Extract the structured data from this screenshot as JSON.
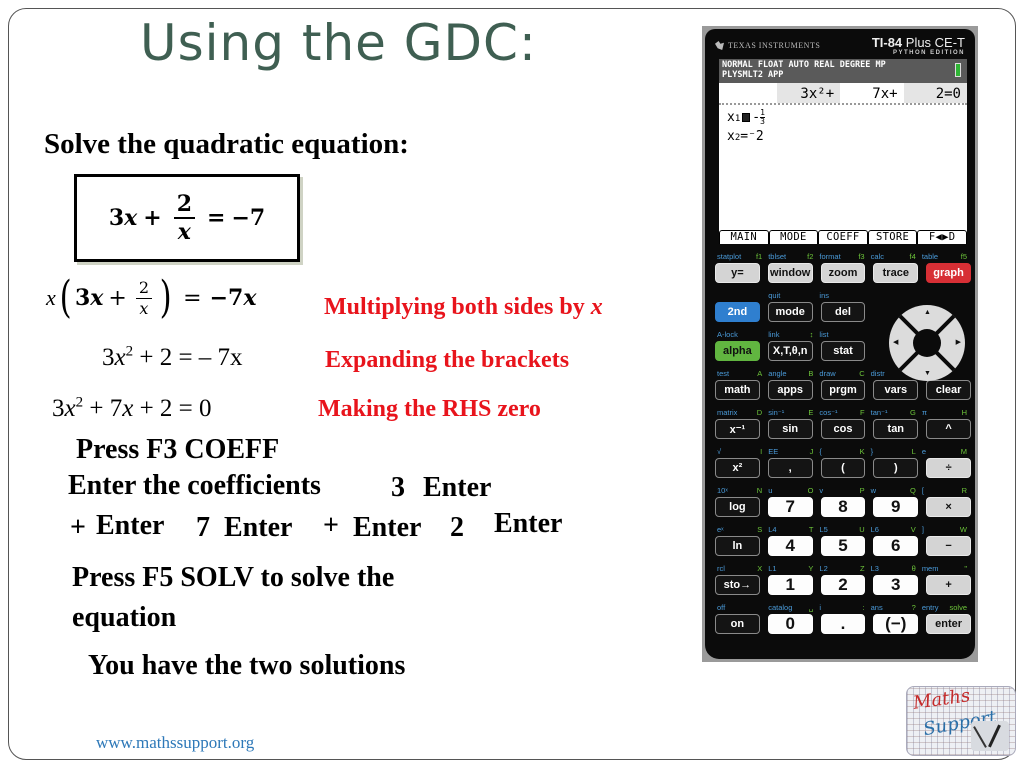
{
  "slide": {
    "title": "Using the GDC:",
    "subtitle": "Solve the quadratic equation:",
    "boxed_equation": {
      "lhs_term": "3",
      "lhs_var": "x",
      "plus": "+",
      "frac_num": "2",
      "frac_den": "x",
      "equals": "=",
      "rhs": "−7"
    },
    "step1": {
      "equation": {
        "lead": "x",
        "term": "3",
        "var": "x",
        "plus": "+",
        "frac_num": "2",
        "frac_den": "x",
        "equals": "=",
        "rhs": "−7",
        "rhs_var": "x"
      },
      "annotation_text": "Multiplying both sides by ",
      "annotation_var": "x"
    },
    "step2": {
      "equation_a": "3",
      "equation_var": "x",
      "equation_exp": "2",
      "equation_b": " + 2 = – 7x",
      "annotation": "Expanding the brackets"
    },
    "step3": {
      "equation_a": "3",
      "equation_var": "x",
      "equation_exp": "2",
      "equation_b": " + 7",
      "equation_var2": "x",
      "equation_c": " + 2 = 0",
      "annotation": "Making the RHS zero"
    },
    "instructions": {
      "press_f3": "Press F3 COEFF",
      "enter_coeffs": "Enter the coefficients",
      "coeff_3": "3",
      "enter_1": "Enter",
      "plus_1": "+",
      "enter_2": "Enter",
      "coeff_7": "7",
      "enter_3": "Enter",
      "plus_2": "+",
      "enter_4": "Enter",
      "coeff_2": "2",
      "enter_5": "Enter",
      "press_f5": "Press F5 SOLV to solve the",
      "press_f5_cont": "equation",
      "two_solutions": "You have the two solutions"
    },
    "footer_link": "www.mathssupport.org",
    "logo": {
      "line1": "Maths",
      "line2": "Support"
    }
  },
  "calculator": {
    "brand": "Texas Instruments",
    "model_prefix": "TI-84",
    "model_suffix": " Plus CE-T",
    "edition": "PYTHON EDITION",
    "screen": {
      "status_line1": "NORMAL FLOAT AUTO REAL DEGREE MP",
      "status_line2": "PLYSMLT2 APP",
      "coefficients": [
        "3x²+",
        "7x+",
        "2=0"
      ],
      "solutions": [
        {
          "label": "x",
          "sub": "1",
          "sign": "-",
          "num": "1",
          "den": "3"
        },
        {
          "label": "x",
          "sub": "2",
          "value": "=⁻2"
        }
      ],
      "menu": [
        "MAIN",
        "MODE",
        "COEFF",
        "STORE",
        "F◀▶D"
      ]
    },
    "rows": [
      {
        "labels": [
          [
            "statplot",
            "f1"
          ],
          [
            "tblset",
            "f2"
          ],
          [
            "format",
            "f3"
          ],
          [
            "calc",
            "f4"
          ],
          [
            "table",
            "f5"
          ]
        ],
        "keys": [
          {
            "t": "y=",
            "c": "gray"
          },
          {
            "t": "window",
            "c": "gray"
          },
          {
            "t": "zoom",
            "c": "gray"
          },
          {
            "t": "trace",
            "c": "gray"
          },
          {
            "t": "graph",
            "c": "red-k"
          }
        ]
      },
      {
        "labels": [
          [
            "",
            ""
          ],
          [
            "quit",
            ""
          ],
          [
            "ins",
            ""
          ],
          [
            "",
            ""
          ],
          [
            "",
            ""
          ]
        ],
        "keys": [
          {
            "t": "2nd",
            "c": "blue-k"
          },
          {
            "t": "mode",
            "c": ""
          },
          {
            "t": "del",
            "c": ""
          },
          {
            "t": "",
            "c": "spacer"
          },
          {
            "t": "",
            "c": "spacer"
          }
        ]
      },
      {
        "labels": [
          [
            "A-lock",
            ""
          ],
          [
            "link",
            "↕"
          ],
          [
            "list",
            ""
          ],
          [
            "",
            ""
          ],
          [
            "",
            ""
          ]
        ],
        "keys": [
          {
            "t": "alpha",
            "c": "green-k"
          },
          {
            "t": "X,T,θ,n",
            "c": ""
          },
          {
            "t": "stat",
            "c": ""
          },
          {
            "t": "",
            "c": "spacer"
          },
          {
            "t": "",
            "c": "spacer"
          }
        ]
      },
      {
        "labels": [
          [
            "test",
            "A"
          ],
          [
            "angle",
            "B"
          ],
          [
            "draw",
            "C"
          ],
          [
            "distr",
            ""
          ],
          [
            "",
            ""
          ]
        ],
        "keys": [
          {
            "t": "math",
            "c": ""
          },
          {
            "t": "apps",
            "c": ""
          },
          {
            "t": "prgm",
            "c": ""
          },
          {
            "t": "vars",
            "c": ""
          },
          {
            "t": "clear",
            "c": ""
          }
        ]
      },
      {
        "labels": [
          [
            "matrix",
            "D"
          ],
          [
            "sin⁻¹",
            "E"
          ],
          [
            "cos⁻¹",
            "F"
          ],
          [
            "tan⁻¹",
            "G"
          ],
          [
            "π",
            "H"
          ]
        ],
        "keys": [
          {
            "t": "x⁻¹",
            "c": ""
          },
          {
            "t": "sin",
            "c": ""
          },
          {
            "t": "cos",
            "c": ""
          },
          {
            "t": "tan",
            "c": ""
          },
          {
            "t": "^",
            "c": ""
          }
        ]
      },
      {
        "labels": [
          [
            "√",
            "I"
          ],
          [
            "EE",
            "J"
          ],
          [
            "{",
            "K"
          ],
          [
            "}",
            "L"
          ],
          [
            "e",
            "M"
          ]
        ],
        "keys": [
          {
            "t": "x²",
            "c": ""
          },
          {
            "t": ",",
            "c": ""
          },
          {
            "t": "(",
            "c": ""
          },
          {
            "t": ")",
            "c": ""
          },
          {
            "t": "÷",
            "c": "gray"
          }
        ]
      },
      {
        "labels": [
          [
            "10ˣ",
            "N"
          ],
          [
            "u",
            "O"
          ],
          [
            "v",
            "P"
          ],
          [
            "w",
            "Q"
          ],
          [
            "[",
            "R"
          ]
        ],
        "keys": [
          {
            "t": "log",
            "c": ""
          },
          {
            "t": "7",
            "c": "white"
          },
          {
            "t": "8",
            "c": "white"
          },
          {
            "t": "9",
            "c": "white"
          },
          {
            "t": "×",
            "c": "gray"
          }
        ]
      },
      {
        "labels": [
          [
            "eˣ",
            "S"
          ],
          [
            "L4",
            "T"
          ],
          [
            "L5",
            "U"
          ],
          [
            "L6",
            "V"
          ],
          [
            "]",
            "W"
          ]
        ],
        "keys": [
          {
            "t": "ln",
            "c": ""
          },
          {
            "t": "4",
            "c": "white"
          },
          {
            "t": "5",
            "c": "white"
          },
          {
            "t": "6",
            "c": "white"
          },
          {
            "t": "−",
            "c": "gray"
          }
        ]
      },
      {
        "labels": [
          [
            "rcl",
            "X"
          ],
          [
            "L1",
            "Y"
          ],
          [
            "L2",
            "Z"
          ],
          [
            "L3",
            "θ"
          ],
          [
            "mem",
            "\""
          ]
        ],
        "keys": [
          {
            "t": "sto→",
            "c": ""
          },
          {
            "t": "1",
            "c": "white"
          },
          {
            "t": "2",
            "c": "white"
          },
          {
            "t": "3",
            "c": "white"
          },
          {
            "t": "+",
            "c": "gray"
          }
        ]
      },
      {
        "labels": [
          [
            "off",
            ""
          ],
          [
            "catalog",
            "␣"
          ],
          [
            "i",
            ":"
          ],
          [
            "ans",
            "?"
          ],
          [
            "entry",
            "solve"
          ]
        ],
        "keys": [
          {
            "t": "on",
            "c": ""
          },
          {
            "t": "0",
            "c": "white"
          },
          {
            "t": ".",
            "c": "white"
          },
          {
            "t": "(−)",
            "c": "white"
          },
          {
            "t": "enter",
            "c": "gray"
          }
        ]
      }
    ],
    "dpad": {
      "up": "▲",
      "down": "▼",
      "left": "◀",
      "right": "▶"
    }
  },
  "colors": {
    "title": "#3f5f52",
    "annotation": "#e8141c",
    "link": "#2d78b8",
    "key_2nd": "#2f7fcf",
    "key_alpha": "#61b540",
    "key_graph": "#d72f35"
  }
}
